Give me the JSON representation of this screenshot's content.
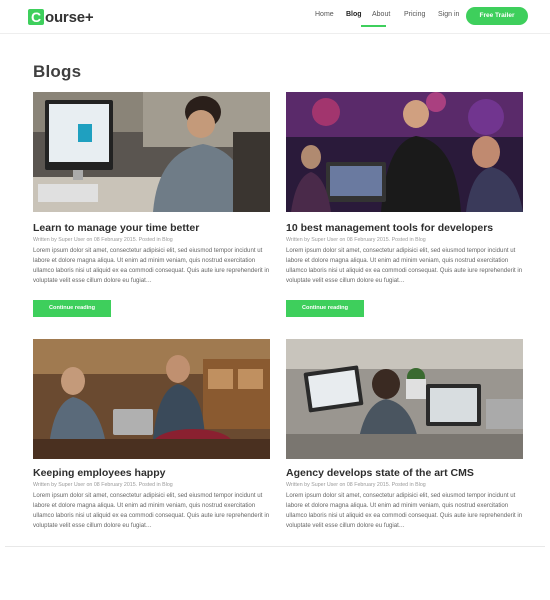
{
  "header": {
    "logo_letter": "C",
    "logo_rest": "ourse+",
    "nav": [
      {
        "label": "Home"
      },
      {
        "label": "Blog"
      },
      {
        "label": "About"
      },
      {
        "label": "Pricing"
      },
      {
        "label": "Sign in"
      }
    ],
    "cta_label": "Free Trailer"
  },
  "main": {
    "title": "Blogs",
    "continue_label": "Continue reading",
    "posts": [
      {
        "title": "Learn to manage your time better",
        "meta": "Written by Super User on 08 February 2015. Posted in Blog",
        "excerpt": "Lorem ipsum dolor sit amet, consectetur adipisici elit, sed eiusmod tempor incidunt ut labore et dolore magna aliqua. Ut enim ad minim veniam, quis nostrud exercitation ullamco laboris nisi ut aliquid ex ea commodi consequat. Quis aute iure reprehenderit in voluptate velit esse cillum dolore eu fugiat…",
        "image": "office-desktop-photo"
      },
      {
        "title": "10 best management tools for developers",
        "meta": "Written by Super User on 08 February 2015. Posted in Blog",
        "excerpt": "Lorem ipsum dolor sit amet, consectetur adipisici elit, sed eiusmod tempor incidunt ut labore et dolore magna aliqua. Ut enim ad minim veniam, quis nostrud exercitation ullamco laboris nisi ut aliquid ex ea commodi consequat. Quis aute iure reprehenderit in voluptate velit esse cillum dolore eu fugiat…",
        "image": "hackathon-photo"
      },
      {
        "title": "Keeping employees happy",
        "meta": "Written by Super User on 08 February 2015. Posted in Blog",
        "excerpt": "Lorem ipsum dolor sit amet, consectetur adipisici elit, sed eiusmod tempor incidunt ut labore et dolore magna aliqua. Ut enim ad minim veniam, quis nostrud exercitation ullamco laboris nisi ut aliquid ex ea commodi consequat. Quis aute iure reprehenderit in voluptate velit esse cillum dolore eu fugiat…",
        "image": "coworkers-photo"
      },
      {
        "title": "Agency develops state of the art CMS",
        "meta": "Written by Super User on 08 February 2015. Posted in Blog",
        "excerpt": "Lorem ipsum dolor sit amet, consectetur adipisici elit, sed eiusmod tempor incidunt ut labore et dolore magna aliqua. Ut enim ad minim veniam, quis nostrud exercitation ullamco laboris nisi ut aliquid ex ea commodi consequat. Quis aute iure reprehenderit in voluptate velit esse cillum dolore eu fugiat…",
        "image": "laptops-team-photo"
      }
    ]
  },
  "colors": {
    "accent": "#3ecf5c",
    "text_dark": "#2e2e2e",
    "text_muted": "#666666"
  }
}
